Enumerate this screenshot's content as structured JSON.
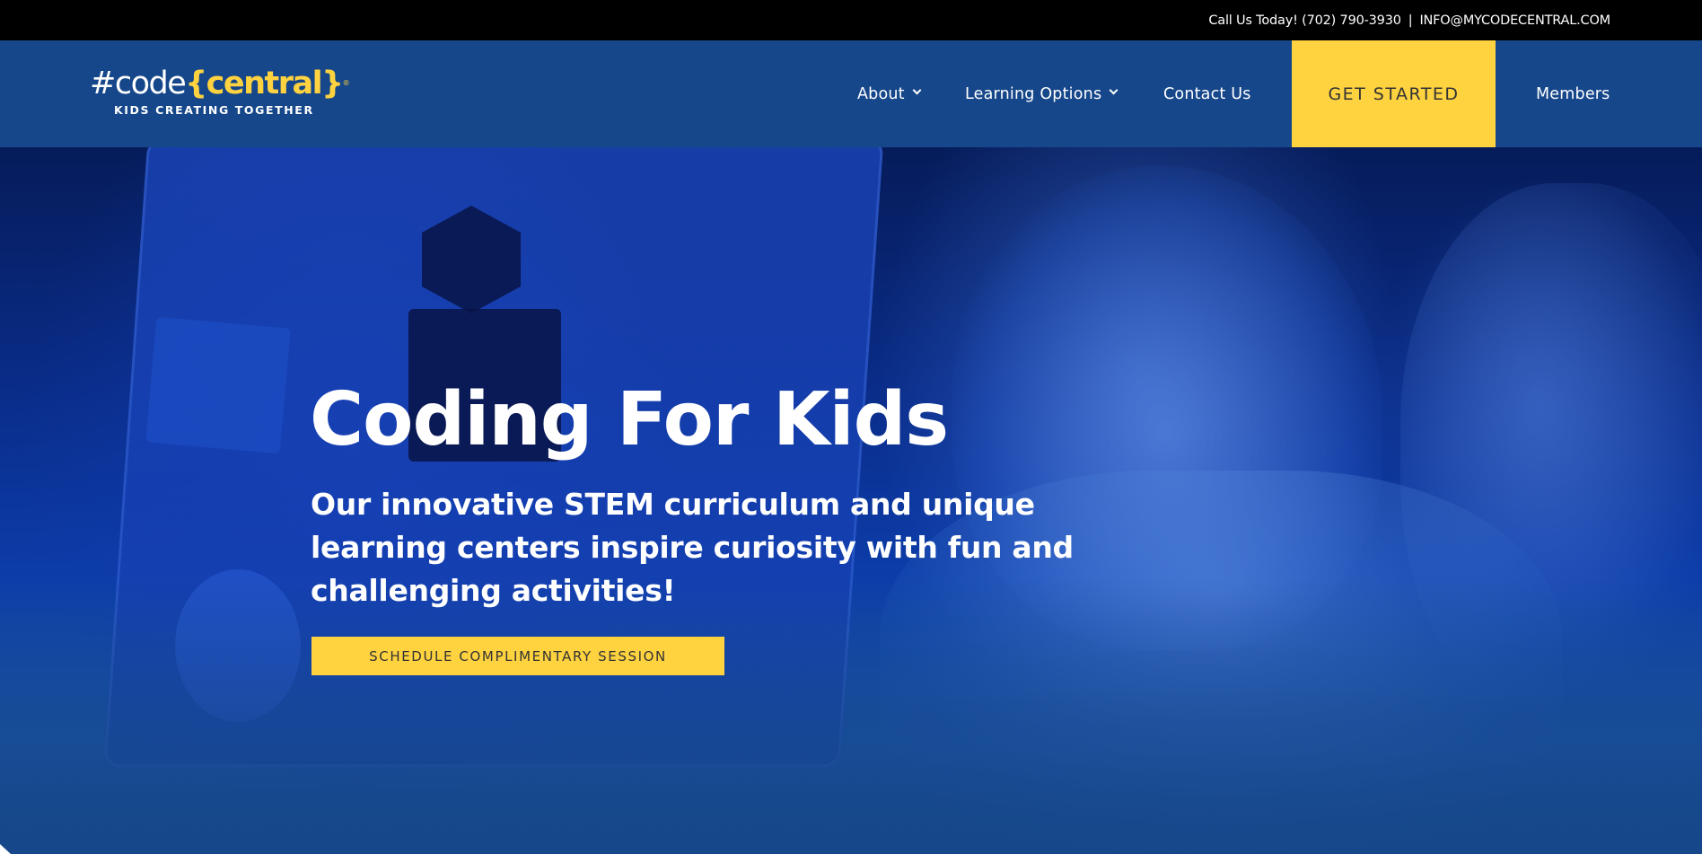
{
  "topbar": {
    "phone": "Call Us Today! (702) 790-3930",
    "separator": "|",
    "email": "INFO@MYCODECENTRAL.COM"
  },
  "logo": {
    "hash_code": "#code",
    "brace_open": "{",
    "central": "central",
    "brace_close": "}",
    "tagline": "KIDS CREATING TOGETHER"
  },
  "nav": {
    "about": "About",
    "learning_options": "Learning Options",
    "contact_us": "Contact Us",
    "get_started": "GET STARTED",
    "members": "Members"
  },
  "hero": {
    "title": "Coding For Kids",
    "subtitle": "Our innovative STEM curriculum and unique learning centers inspire curiosity with fun and challenging activities!",
    "cta": "SCHEDULE COMPLIMENTARY SESSION"
  },
  "colors": {
    "accent": "#ffd23f",
    "header_bg": "#16478a",
    "topbar_bg": "#000000"
  }
}
